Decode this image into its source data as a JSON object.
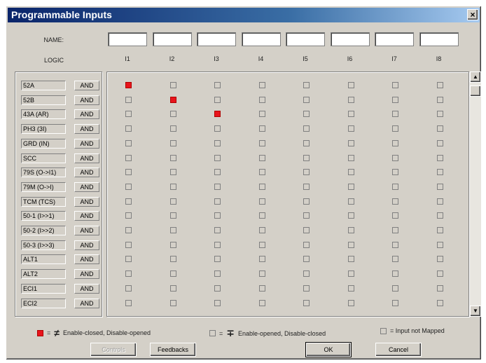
{
  "window": {
    "title": "Programmable Inputs",
    "close_glyph": "×"
  },
  "labels": {
    "name": "NAME:",
    "logic": "LOGIC"
  },
  "columns": [
    "I1",
    "I2",
    "I3",
    "I4",
    "I5",
    "I6",
    "I7",
    "I8"
  ],
  "name_values": [
    "",
    "",
    "",
    "",
    "",
    "",
    "",
    ""
  ],
  "rows": [
    {
      "name": "52A",
      "logic": "AND",
      "cells": [
        1,
        0,
        0,
        0,
        0,
        0,
        0,
        0
      ]
    },
    {
      "name": "52B",
      "logic": "AND",
      "cells": [
        0,
        1,
        0,
        0,
        0,
        0,
        0,
        0
      ]
    },
    {
      "name": "43A (AR)",
      "logic": "AND",
      "cells": [
        0,
        0,
        1,
        0,
        0,
        0,
        0,
        0
      ]
    },
    {
      "name": "PH3 (3I)",
      "logic": "AND",
      "cells": [
        0,
        0,
        0,
        0,
        0,
        0,
        0,
        0
      ]
    },
    {
      "name": "GRD (IN)",
      "logic": "AND",
      "cells": [
        0,
        0,
        0,
        0,
        0,
        0,
        0,
        0
      ]
    },
    {
      "name": "SCC",
      "logic": "AND",
      "cells": [
        0,
        0,
        0,
        0,
        0,
        0,
        0,
        0
      ]
    },
    {
      "name": "79S (O->I1)",
      "logic": "AND",
      "cells": [
        0,
        0,
        0,
        0,
        0,
        0,
        0,
        0
      ]
    },
    {
      "name": "79M (O->I)",
      "logic": "AND",
      "cells": [
        0,
        0,
        0,
        0,
        0,
        0,
        0,
        0
      ]
    },
    {
      "name": "TCM (TCS)",
      "logic": "AND",
      "cells": [
        0,
        0,
        0,
        0,
        0,
        0,
        0,
        0
      ]
    },
    {
      "name": "50-1 (I>>1)",
      "logic": "AND",
      "cells": [
        0,
        0,
        0,
        0,
        0,
        0,
        0,
        0
      ]
    },
    {
      "name": "50-2 (I>>2)",
      "logic": "AND",
      "cells": [
        0,
        0,
        0,
        0,
        0,
        0,
        0,
        0
      ]
    },
    {
      "name": "50-3 (I>>3)",
      "logic": "AND",
      "cells": [
        0,
        0,
        0,
        0,
        0,
        0,
        0,
        0
      ]
    },
    {
      "name": "ALT1",
      "logic": "AND",
      "cells": [
        0,
        0,
        0,
        0,
        0,
        0,
        0,
        0
      ]
    },
    {
      "name": "ALT2",
      "logic": "AND",
      "cells": [
        0,
        0,
        0,
        0,
        0,
        0,
        0,
        0
      ]
    },
    {
      "name": "ECI1",
      "logic": "AND",
      "cells": [
        0,
        0,
        0,
        0,
        0,
        0,
        0,
        0
      ]
    },
    {
      "name": "ECI2",
      "logic": "AND",
      "cells": [
        0,
        0,
        0,
        0,
        0,
        0,
        0,
        0
      ]
    }
  ],
  "scrollbar": {
    "up_glyph": "▲",
    "down_glyph": "▼"
  },
  "legend": {
    "closed_text": "Enable-closed, Disable-opened",
    "opened_text": "Enable-opened, Disable-closed",
    "unmapped_text": "= Input not Mapped",
    "equals": "=",
    "closed_symbol": "≠",
    "opened_symbol": "∓"
  },
  "buttons": {
    "controls": "Controls",
    "feedbacks": "Feedbacks",
    "ok": "OK",
    "cancel": "Cancel"
  },
  "colors": {
    "active": "#e8141c",
    "face": "#d4d0c8",
    "title": "#0a246a"
  }
}
